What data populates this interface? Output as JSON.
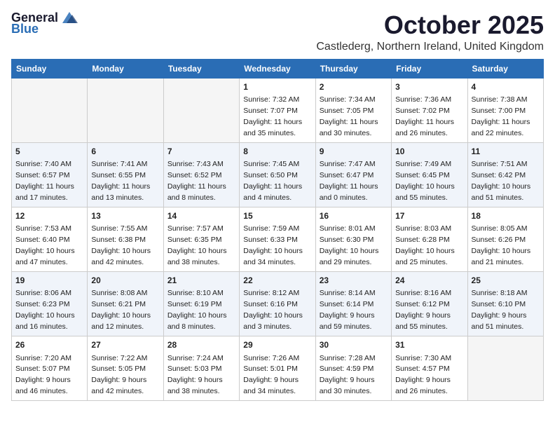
{
  "logo": {
    "general": "General",
    "blue": "Blue"
  },
  "title": "October 2025",
  "location": "Castlederg, Northern Ireland, United Kingdom",
  "days_of_week": [
    "Sunday",
    "Monday",
    "Tuesday",
    "Wednesday",
    "Thursday",
    "Friday",
    "Saturday"
  ],
  "weeks": [
    [
      {
        "day": "",
        "info": ""
      },
      {
        "day": "",
        "info": ""
      },
      {
        "day": "",
        "info": ""
      },
      {
        "day": "1",
        "info": "Sunrise: 7:32 AM\nSunset: 7:07 PM\nDaylight: 11 hours and 35 minutes."
      },
      {
        "day": "2",
        "info": "Sunrise: 7:34 AM\nSunset: 7:05 PM\nDaylight: 11 hours and 30 minutes."
      },
      {
        "day": "3",
        "info": "Sunrise: 7:36 AM\nSunset: 7:02 PM\nDaylight: 11 hours and 26 minutes."
      },
      {
        "day": "4",
        "info": "Sunrise: 7:38 AM\nSunset: 7:00 PM\nDaylight: 11 hours and 22 minutes."
      }
    ],
    [
      {
        "day": "5",
        "info": "Sunrise: 7:40 AM\nSunset: 6:57 PM\nDaylight: 11 hours and 17 minutes."
      },
      {
        "day": "6",
        "info": "Sunrise: 7:41 AM\nSunset: 6:55 PM\nDaylight: 11 hours and 13 minutes."
      },
      {
        "day": "7",
        "info": "Sunrise: 7:43 AM\nSunset: 6:52 PM\nDaylight: 11 hours and 8 minutes."
      },
      {
        "day": "8",
        "info": "Sunrise: 7:45 AM\nSunset: 6:50 PM\nDaylight: 11 hours and 4 minutes."
      },
      {
        "day": "9",
        "info": "Sunrise: 7:47 AM\nSunset: 6:47 PM\nDaylight: 11 hours and 0 minutes."
      },
      {
        "day": "10",
        "info": "Sunrise: 7:49 AM\nSunset: 6:45 PM\nDaylight: 10 hours and 55 minutes."
      },
      {
        "day": "11",
        "info": "Sunrise: 7:51 AM\nSunset: 6:42 PM\nDaylight: 10 hours and 51 minutes."
      }
    ],
    [
      {
        "day": "12",
        "info": "Sunrise: 7:53 AM\nSunset: 6:40 PM\nDaylight: 10 hours and 47 minutes."
      },
      {
        "day": "13",
        "info": "Sunrise: 7:55 AM\nSunset: 6:38 PM\nDaylight: 10 hours and 42 minutes."
      },
      {
        "day": "14",
        "info": "Sunrise: 7:57 AM\nSunset: 6:35 PM\nDaylight: 10 hours and 38 minutes."
      },
      {
        "day": "15",
        "info": "Sunrise: 7:59 AM\nSunset: 6:33 PM\nDaylight: 10 hours and 34 minutes."
      },
      {
        "day": "16",
        "info": "Sunrise: 8:01 AM\nSunset: 6:30 PM\nDaylight: 10 hours and 29 minutes."
      },
      {
        "day": "17",
        "info": "Sunrise: 8:03 AM\nSunset: 6:28 PM\nDaylight: 10 hours and 25 minutes."
      },
      {
        "day": "18",
        "info": "Sunrise: 8:05 AM\nSunset: 6:26 PM\nDaylight: 10 hours and 21 minutes."
      }
    ],
    [
      {
        "day": "19",
        "info": "Sunrise: 8:06 AM\nSunset: 6:23 PM\nDaylight: 10 hours and 16 minutes."
      },
      {
        "day": "20",
        "info": "Sunrise: 8:08 AM\nSunset: 6:21 PM\nDaylight: 10 hours and 12 minutes."
      },
      {
        "day": "21",
        "info": "Sunrise: 8:10 AM\nSunset: 6:19 PM\nDaylight: 10 hours and 8 minutes."
      },
      {
        "day": "22",
        "info": "Sunrise: 8:12 AM\nSunset: 6:16 PM\nDaylight: 10 hours and 3 minutes."
      },
      {
        "day": "23",
        "info": "Sunrise: 8:14 AM\nSunset: 6:14 PM\nDaylight: 9 hours and 59 minutes."
      },
      {
        "day": "24",
        "info": "Sunrise: 8:16 AM\nSunset: 6:12 PM\nDaylight: 9 hours and 55 minutes."
      },
      {
        "day": "25",
        "info": "Sunrise: 8:18 AM\nSunset: 6:10 PM\nDaylight: 9 hours and 51 minutes."
      }
    ],
    [
      {
        "day": "26",
        "info": "Sunrise: 7:20 AM\nSunset: 5:07 PM\nDaylight: 9 hours and 46 minutes."
      },
      {
        "day": "27",
        "info": "Sunrise: 7:22 AM\nSunset: 5:05 PM\nDaylight: 9 hours and 42 minutes."
      },
      {
        "day": "28",
        "info": "Sunrise: 7:24 AM\nSunset: 5:03 PM\nDaylight: 9 hours and 38 minutes."
      },
      {
        "day": "29",
        "info": "Sunrise: 7:26 AM\nSunset: 5:01 PM\nDaylight: 9 hours and 34 minutes."
      },
      {
        "day": "30",
        "info": "Sunrise: 7:28 AM\nSunset: 4:59 PM\nDaylight: 9 hours and 30 minutes."
      },
      {
        "day": "31",
        "info": "Sunrise: 7:30 AM\nSunset: 4:57 PM\nDaylight: 9 hours and 26 minutes."
      },
      {
        "day": "",
        "info": ""
      }
    ]
  ]
}
